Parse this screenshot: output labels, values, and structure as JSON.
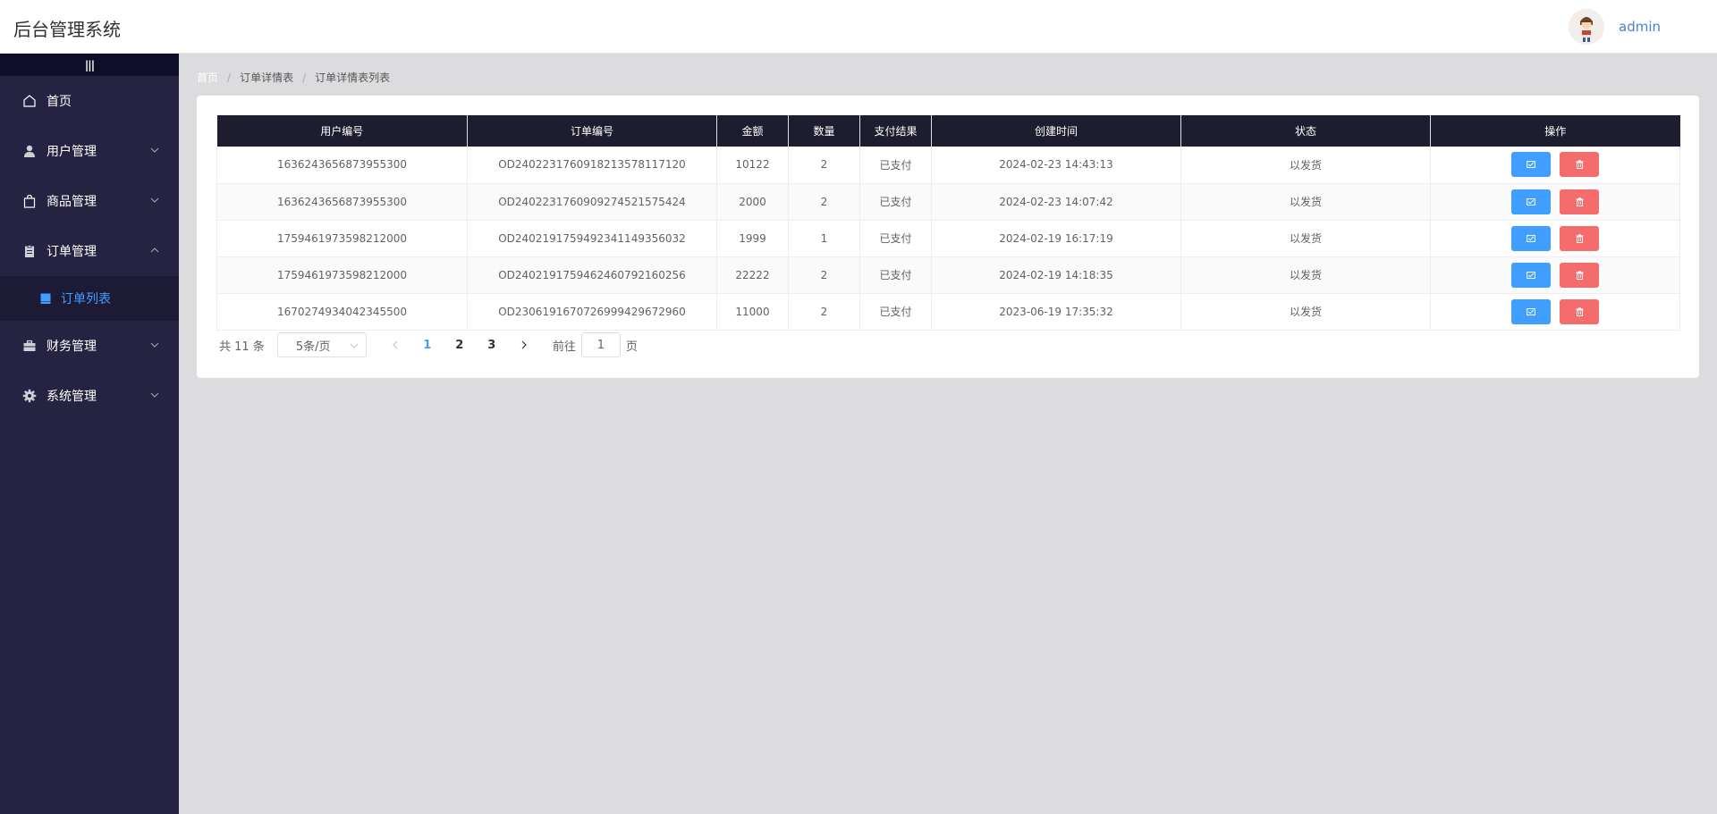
{
  "app": {
    "title": "后台管理系统",
    "username": "admin"
  },
  "sidebar": {
    "items": [
      {
        "label": "首页"
      },
      {
        "label": "用户管理"
      },
      {
        "label": "商品管理"
      },
      {
        "label": "订单管理"
      },
      {
        "label": "订单列表"
      },
      {
        "label": "财务管理"
      },
      {
        "label": "系统管理"
      }
    ]
  },
  "breadcrumb": [
    "首页",
    "订单详情表",
    "订单详情表列表"
  ],
  "table": {
    "headers": [
      "用户编号",
      "订单编号",
      "金额",
      "数量",
      "支付结果",
      "创建时间",
      "状态",
      "操作"
    ],
    "rows": [
      [
        "1636243656873955300",
        "OD24022317609182135781171​20",
        "10122",
        "2",
        "已支付",
        "2024-02-23 14:43:13",
        "以发货"
      ],
      [
        "1636243656873955300",
        "OD24022317609092745215754​24",
        "2000",
        "2",
        "已支付",
        "2024-02-23 14:07:42",
        "以发货"
      ],
      [
        "1759461973598212000",
        "OD24021917594923411493560​32",
        "1999",
        "1",
        "已支付",
        "2024-02-19 16:17:19",
        "以发货"
      ],
      [
        "1759461973598212000",
        "OD24021917594624607921602​56",
        "22222",
        "2",
        "已支付",
        "2024-02-19 14:18:35",
        "以发货"
      ],
      [
        "1670274934042345500",
        "OD23061916707269994296729​60",
        "11000",
        "2",
        "已支付",
        "2023-06-19 17:35:32",
        "以发货"
      ]
    ]
  },
  "pagination": {
    "total": "共 11 条",
    "page_size": "5条/页",
    "pages": [
      "1",
      "2",
      "3"
    ],
    "goto_label": "前往",
    "goto_value": "1",
    "page_suffix": "页"
  },
  "colors": {
    "sidebar": "#252341",
    "accent": "#409eff",
    "danger": "#f56c6c",
    "table_header": "#1e1d30"
  }
}
